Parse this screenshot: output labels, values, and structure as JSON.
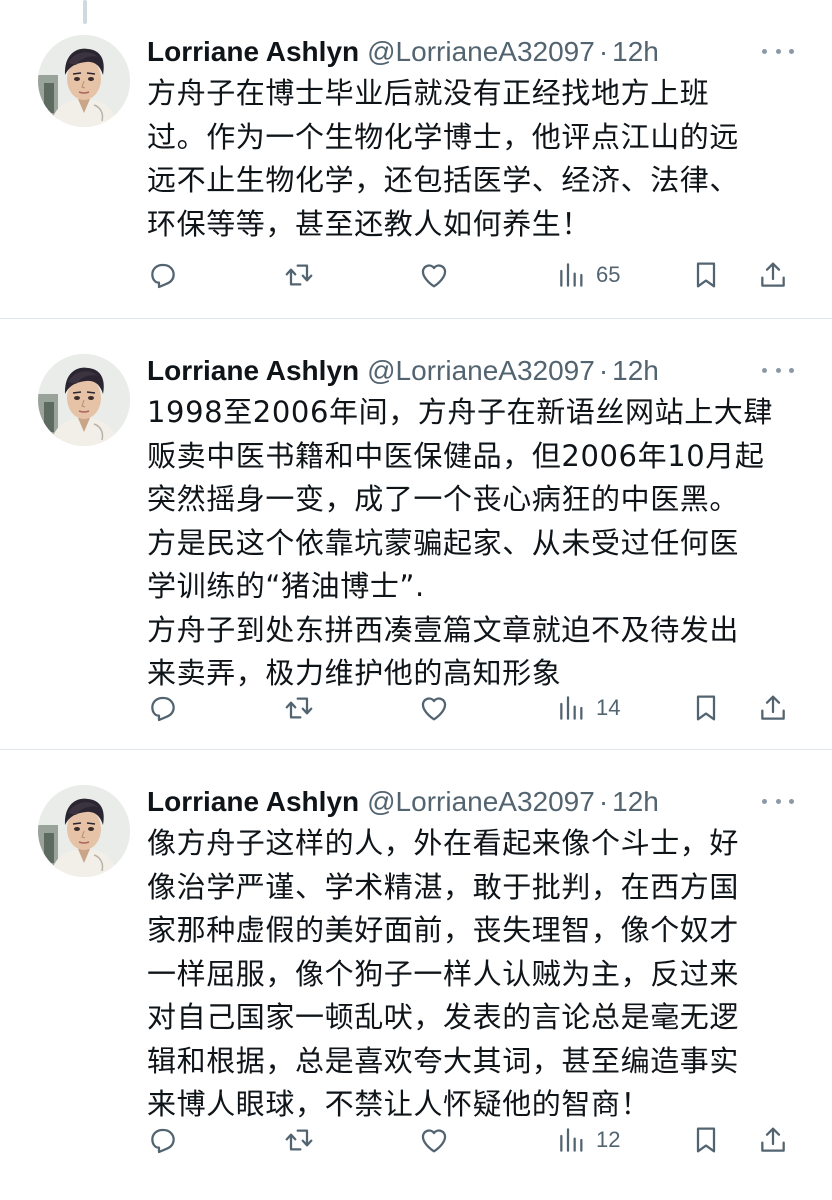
{
  "colors": {
    "text_primary": "#0f1419",
    "text_secondary": "#536471",
    "divider": "#e1e6ea",
    "icon": "#536471"
  },
  "icons": {
    "reply": "reply-icon",
    "retweet": "retweet-icon",
    "like": "heart-icon",
    "views": "views-chart-icon",
    "bookmark": "bookmark-icon",
    "share": "share-icon",
    "more": "more-dots-icon"
  },
  "tweets": [
    {
      "name": "Lorriane Ashlyn",
      "handle": "@LorrianeA32097",
      "separator": "·",
      "time": "12h",
      "text": "方舟子在博士毕业后就没有正经找地方上班\n过。作为一个生物化学博士，他评点江山的远\n远不止生物化学，还包括医学、经济、法律、\n环保等等，甚至还教人如何养生！",
      "views": "65"
    },
    {
      "name": "Lorriane Ashlyn",
      "handle": "@LorrianeA32097",
      "separator": "·",
      "time": "12h",
      "text": "1998至2006年间，方舟子在新语丝网站上大肆\n贩卖中医书籍和中医保健品，但2006年10月起\n突然摇身一变，成了一个丧心病狂的中医黑。\n方是民这个依靠坑蒙骗起家、从未受过任何医\n学训练的“猪油博士”.\n方舟子到处东拼西凑壹篇文章就迫不及待发出\n来卖弄，极力维护他的高知形象",
      "views": "14"
    },
    {
      "name": "Lorriane Ashlyn",
      "handle": "@LorrianeA32097",
      "separator": "·",
      "time": "12h",
      "text": "像方舟子这样的人，外在看起来像个斗士，好\n像治学严谨、学术精湛，敢于批判，在西方国\n家那种虚假的美好面前，丧失理智，像个奴才\n一样屈服，像个狗子一样人认贼为主，反过来\n对自己国家一顿乱吠，发表的言论总是毫无逻\n辑和根据，总是喜欢夸大其词，甚至编造事实\n来博人眼球，不禁让人怀疑他的智商！",
      "views": "12"
    }
  ]
}
